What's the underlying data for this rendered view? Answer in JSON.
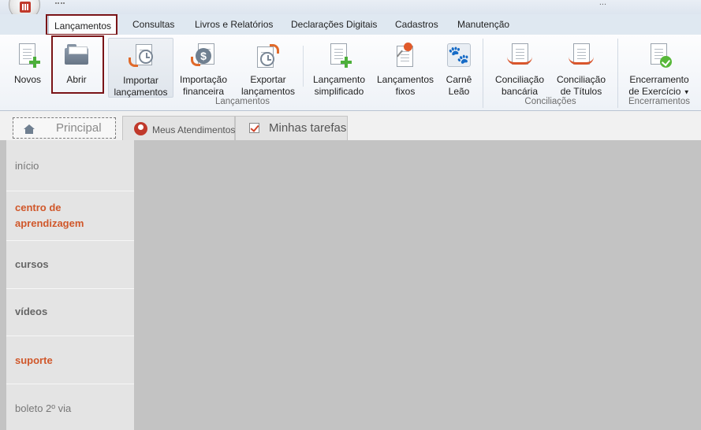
{
  "window": {
    "title_fragment": "..."
  },
  "ribbon_tabs": [
    {
      "label": "Lançamentos",
      "active": true
    },
    {
      "label": "Consultas"
    },
    {
      "label": "Livros e Relatórios"
    },
    {
      "label": "Declarações Digitais"
    },
    {
      "label": "Cadastros"
    },
    {
      "label": "Manutenção"
    }
  ],
  "ribbon": {
    "buttons": {
      "novos": {
        "label": "Novos",
        "icon": "new-document-icon"
      },
      "abrir": {
        "label": "Abrir",
        "icon": "open-folder-icon"
      },
      "importar": {
        "line1": "Importar",
        "line2": "lançamentos",
        "icon": "import-entries-icon"
      },
      "importacao": {
        "line1": "Importação",
        "line2": "financeira",
        "icon": "financial-import-icon"
      },
      "exportar": {
        "line1": "Exportar",
        "line2": "lançamentos",
        "icon": "export-entries-icon"
      },
      "simplificado": {
        "line1": "Lançamento",
        "line2": "simplificado",
        "icon": "simplified-entry-icon"
      },
      "fixos": {
        "line1": "Lançamentos",
        "line2": "fixos",
        "icon": "fixed-entries-pin-icon"
      },
      "carne": {
        "line1": "Carnê",
        "line2": "Leão",
        "icon": "paw-icon"
      },
      "conc_bancaria": {
        "line1": "Conciliação",
        "line2": "bancária",
        "icon": "bank-reconciliation-icon"
      },
      "conc_titulos": {
        "line1": "Conciliação",
        "line2": "de Títulos",
        "icon": "titles-reconciliation-icon"
      },
      "encerramento": {
        "line1": "Encerramento",
        "line2": "de Exercício",
        "icon": "fiscal-year-closing-icon"
      }
    },
    "groups": {
      "lancamentos": "Lançamentos",
      "conciliacoes": "Conciliações",
      "encerramentos": "Encerramentos"
    }
  },
  "doc_tabs": [
    {
      "label": "Principal",
      "icon": "home-icon",
      "active": true
    },
    {
      "label": "Meus Atendimentos",
      "icon": "person-icon"
    },
    {
      "label": "Minhas tarefas",
      "icon": "tasks-check-icon"
    }
  ],
  "sidebar": {
    "items": [
      {
        "label": "início",
        "style": "normal"
      },
      {
        "label": "centro de aprendizagem",
        "style": "accent"
      },
      {
        "label": "cursos",
        "style": "bold"
      },
      {
        "label": "vídeos",
        "style": "bold"
      },
      {
        "label": "suporte",
        "style": "accent"
      },
      {
        "label": "boleto 2º via",
        "style": "normal"
      }
    ]
  },
  "colors": {
    "highlight_box": "#7a1417",
    "accent_orange": "#d0572a",
    "content_bg": "#c3c3c3"
  }
}
